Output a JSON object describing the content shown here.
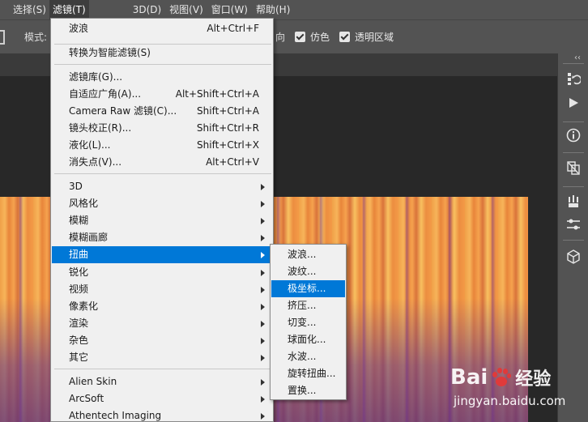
{
  "menubar": {
    "items": [
      {
        "label": "选择(S)"
      },
      {
        "label": "滤镜(T)"
      },
      {
        "label": "3D(D)"
      },
      {
        "label": "视图(V)"
      },
      {
        "label": "窗口(W)"
      },
      {
        "label": "帮助(H)"
      }
    ]
  },
  "options_bar": {
    "mode_label": "模式:",
    "direction_label": "向",
    "dither_label": "仿色",
    "transparency_label": "透明区域"
  },
  "filter_menu": {
    "items": [
      {
        "label": "波浪",
        "shortcut": "Alt+Ctrl+F"
      },
      {
        "label": "转换为智能滤镜(S)"
      },
      {
        "label": "滤镜库(G)..."
      },
      {
        "label": "自适应广角(A)...",
        "shortcut": "Alt+Shift+Ctrl+A"
      },
      {
        "label": "Camera Raw 滤镜(C)...",
        "shortcut": "Shift+Ctrl+A"
      },
      {
        "label": "镜头校正(R)...",
        "shortcut": "Shift+Ctrl+R"
      },
      {
        "label": "液化(L)...",
        "shortcut": "Shift+Ctrl+X"
      },
      {
        "label": "消失点(V)...",
        "shortcut": "Alt+Ctrl+V"
      },
      {
        "label": "3D"
      },
      {
        "label": "风格化"
      },
      {
        "label": "模糊"
      },
      {
        "label": "模糊画廊"
      },
      {
        "label": "扭曲"
      },
      {
        "label": "锐化"
      },
      {
        "label": "视频"
      },
      {
        "label": "像素化"
      },
      {
        "label": "渲染"
      },
      {
        "label": "杂色"
      },
      {
        "label": "其它"
      },
      {
        "label": "Alien Skin"
      },
      {
        "label": "ArcSoft"
      },
      {
        "label": "Athentech Imaging"
      }
    ]
  },
  "distort_submenu": {
    "items": [
      {
        "label": "波浪..."
      },
      {
        "label": "波纹..."
      },
      {
        "label": "极坐标..."
      },
      {
        "label": "挤压..."
      },
      {
        "label": "切变..."
      },
      {
        "label": "球面化..."
      },
      {
        "label": "水波..."
      },
      {
        "label": "旋转扭曲..."
      },
      {
        "label": "置换..."
      }
    ]
  },
  "right_panel": {
    "collapse": "‹‹"
  },
  "watermark": {
    "brand_a": "Bai",
    "brand_b": "经验",
    "url": "jingyan.baidu.com"
  },
  "colors": {
    "highlight": "#0078d7",
    "menu_bg": "#f0f0f0",
    "chrome": "#535353"
  }
}
